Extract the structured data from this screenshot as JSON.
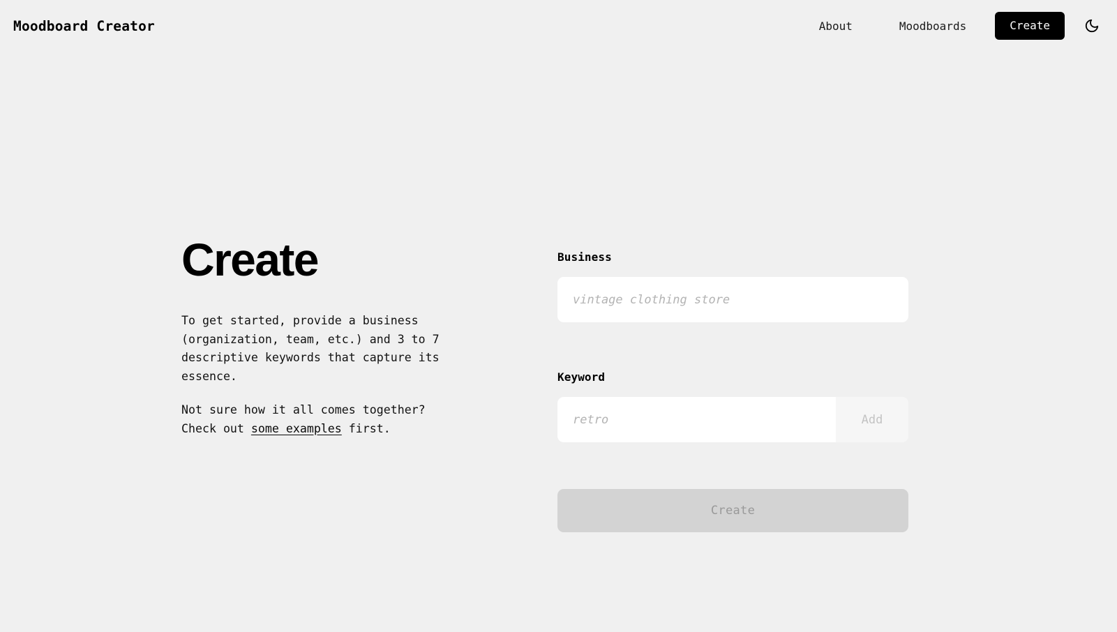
{
  "header": {
    "brand": "Moodboard Creator",
    "nav": [
      {
        "label": "About",
        "name": "nav-link-about"
      },
      {
        "label": "Moodboards",
        "name": "nav-link-moodboards"
      }
    ],
    "cta_label": "Create",
    "theme_toggle_icon": "moon-icon",
    "theme_toggle_title": "Toggle dark mode"
  },
  "intro": {
    "title": "Create",
    "paragraph_1": "To get started, provide a business (organization, team, etc.) and 3 to 7 descriptive keywords that capture its essence.",
    "paragraph_2_before": "Not sure how it all comes together? Check out ",
    "paragraph_2_link": "some examples",
    "paragraph_2_after": " first."
  },
  "form": {
    "business": {
      "label": "Business",
      "value": "",
      "placeholder": "vintage clothing store"
    },
    "keyword": {
      "label": "Keyword",
      "value": "",
      "placeholder": "retro",
      "add_label": "Add"
    },
    "submit_label": "Create"
  },
  "colors": {
    "background": "#f0f0f0",
    "accent": "#000000",
    "input_background": "#ffffff",
    "disabled_button_bg": "#d3d3d3",
    "disabled_button_text": "#999999",
    "placeholder": "#b3b3b3"
  }
}
